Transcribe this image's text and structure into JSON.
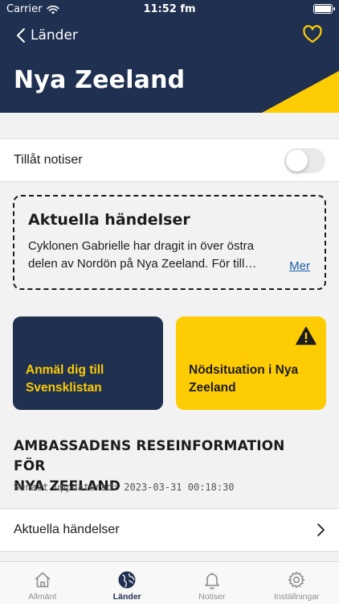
{
  "status": {
    "carrier": "Carrier",
    "time": "11:52 fm"
  },
  "header": {
    "back_label": "Länder",
    "title": "Nya Zeeland"
  },
  "notifications": {
    "label": "Tillåt notiser",
    "enabled": false
  },
  "events_card": {
    "title": "Aktuella händelser",
    "line1": "Cyklonen Gabrielle har dragit in över östra",
    "line2": "delen av Nordön på Nya Zeeland. För till…",
    "more": "Mer"
  },
  "tiles": {
    "register_line1": "Anmäl dig till",
    "register_line2": "Svensklistan",
    "emergency_line1": "Nödsituation i Nya",
    "emergency_line2": "Zeeland"
  },
  "section": {
    "title_line1": "AMBASSADENS RESEINFORMATION FÖR",
    "title_line2": "NYA ZEELAND",
    "updated": "Senast uppdaterad: 2023-03-31 00:18:30"
  },
  "nav_row": {
    "label": "Aktuella händelser"
  },
  "tabbar": {
    "tabs": [
      {
        "label": "Allmänt",
        "icon": "house-icon"
      },
      {
        "label": "Länder",
        "icon": "globe-icon"
      },
      {
        "label": "Notiser",
        "icon": "bell-icon"
      },
      {
        "label": "Inställningar",
        "icon": "gear-icon"
      }
    ],
    "active": "Länder"
  },
  "colors": {
    "navy": "#1f3050",
    "yellow": "#fecc02",
    "link": "#1a5ea8"
  }
}
